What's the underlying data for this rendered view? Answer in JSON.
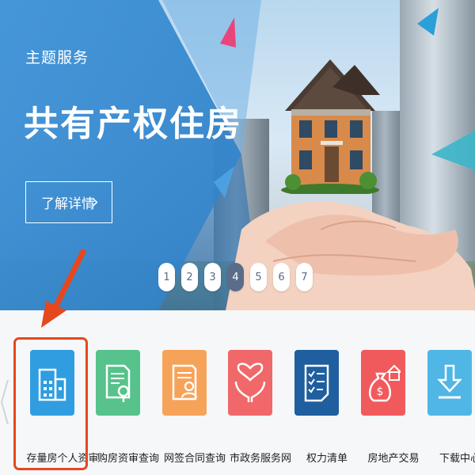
{
  "banner": {
    "subtitle": "主题服务",
    "title": "共有产权住房",
    "detail_button": "了解详情",
    "pagination": [
      "1",
      "2",
      "3",
      "4",
      "5",
      "6",
      "7"
    ],
    "active_page": "4"
  },
  "services": {
    "items": [
      {
        "label": "存量房个人资审",
        "icon": "building-icon",
        "color": "#2f9de0"
      },
      {
        "label": "购房资审查询",
        "icon": "document-search-icon",
        "color": "#57c28b"
      },
      {
        "label": "网签合同查询",
        "icon": "contract-person-icon",
        "color": "#f6a35a"
      },
      {
        "label": "市政务服务网",
        "icon": "heart-hands-icon",
        "color": "#f0686a"
      },
      {
        "label": "权力清单",
        "icon": "checklist-icon",
        "color": "#1f5e9f"
      },
      {
        "label": "房地产交易",
        "icon": "money-bag-house-icon",
        "color": "#f15a5c"
      },
      {
        "label": "下载中心",
        "icon": "download-icon",
        "color": "#4fb6e6"
      }
    ],
    "highlighted_index": 0
  },
  "colors": {
    "banner_panel": "#3d8fd4",
    "highlight_border": "#e5471f",
    "pointer_arrow": "#e5471f"
  }
}
